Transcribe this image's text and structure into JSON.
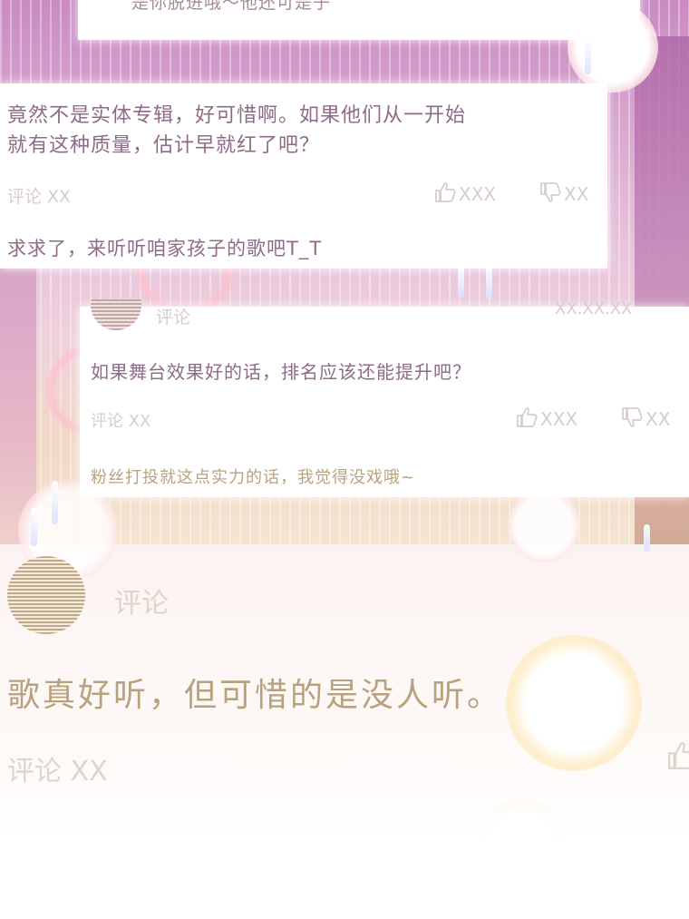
{
  "colors": {
    "comment_text": "#8e6b86",
    "meta_text": "#d6ccd2",
    "gold_text": "#b8a27e",
    "gold_meta": "#ddd6c8"
  },
  "top_card": {
    "cut_text": "是你脱进哦～他还可是子"
  },
  "comment_1": {
    "body_line1": "竟然不是实体专辑，好可惜啊。如果他们从一开始",
    "body_line2": "就有这种质量，估计早就红了吧？",
    "meta": "评论 XX",
    "likes": "XXX",
    "dislikes": "XX",
    "reply": "求求了，来听听咱家孩子的歌吧T_T",
    "like_icon": "thumbs-up-icon",
    "dislike_icon": "thumbs-down-icon"
  },
  "comment_2": {
    "username": "评论",
    "date": "XX.XX.XX",
    "body": "如果舞台效果好的话，排名应该还能提升吧？",
    "meta": "评论 XX",
    "likes": "XXX",
    "dislikes": "XX",
    "reply": "粉丝打投就这点实力的话，我觉得没戏哦~"
  },
  "comment_3": {
    "username": "评论",
    "body": "歌真好听，但可惜的是没人听。",
    "meta": "评论 XX"
  }
}
